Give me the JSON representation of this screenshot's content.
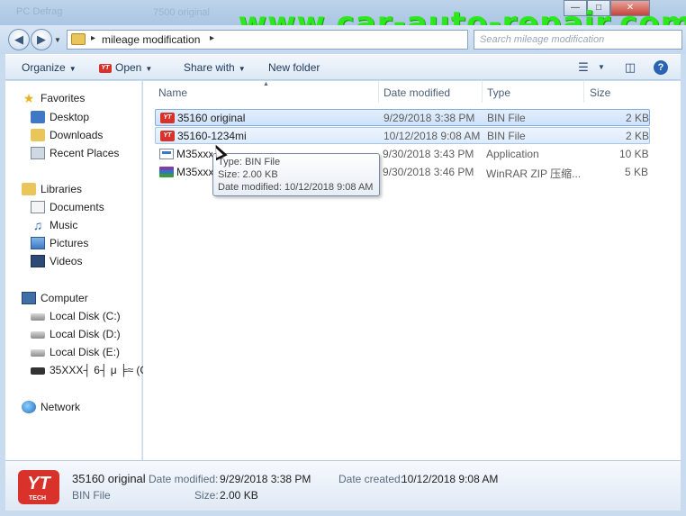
{
  "window": {
    "ghost_title_left": "PC Defrag",
    "ghost_title_right": "7500 original",
    "watermark": "www.car-auto-repair.com"
  },
  "address": {
    "path": [
      "mileage modification"
    ],
    "search_placeholder": "Search mileage modification"
  },
  "toolbar": {
    "organize": "Organize",
    "open": "Open",
    "share_with": "Share with",
    "new_folder": "New folder"
  },
  "navpane": {
    "favorites": "Favorites",
    "desktop": "Desktop",
    "downloads": "Downloads",
    "recent_places": "Recent Places",
    "libraries": "Libraries",
    "documents": "Documents",
    "music": "Music",
    "pictures": "Pictures",
    "videos": "Videos",
    "computer": "Computer",
    "disk_c": "Local Disk (C:)",
    "disk_d": "Local Disk (D:)",
    "disk_e": "Local Disk (E:)",
    "disk_g": "35XXX┤ 6┤ μ ╞≈ (G",
    "network": "Network"
  },
  "columns": {
    "name": "Name",
    "date_modified": "Date modified",
    "type": "Type",
    "size": "Size"
  },
  "files": [
    {
      "name": "35160 original",
      "date": "9/29/2018 3:38 PM",
      "type": "BIN File",
      "size": "2 KB",
      "icon": "yanhua-logo-icon"
    },
    {
      "name": "35160-1234mi",
      "date": "10/12/2018 9:08 AM",
      "type": "BIN File",
      "size": "2 KB",
      "icon": "yanhua-logo-icon"
    },
    {
      "name": "M35xxx-mileage modification tool",
      "date": "9/30/2018 3:43 PM",
      "type": "Application",
      "size": "10 KB",
      "icon": "application-icon"
    },
    {
      "name": "M35xxx",
      "date": "9/30/2018 3:46 PM",
      "type": "WinRAR ZIP 压缩...",
      "size": "5 KB",
      "icon": "winrar-icon"
    }
  ],
  "tooltip": {
    "type": "Type: BIN File",
    "size": "Size: 2.00 KB",
    "date": "Date modified: 10/12/2018 9:08 AM"
  },
  "details": {
    "name": "35160 original",
    "filetype": "BIN File",
    "modified_label": "Date modified:",
    "modified_value": "9/29/2018 3:38 PM",
    "created_label": "Date created:",
    "created_value": "10/12/2018 9:08 AM",
    "size_label": "Size:",
    "size_value": "2.00 KB",
    "logo_text": "YT",
    "logo_sub": "TECH"
  },
  "colors": {
    "accent": "#2a63b3",
    "brand_red": "#d9322b",
    "watermark_green": "#2ee81f"
  }
}
